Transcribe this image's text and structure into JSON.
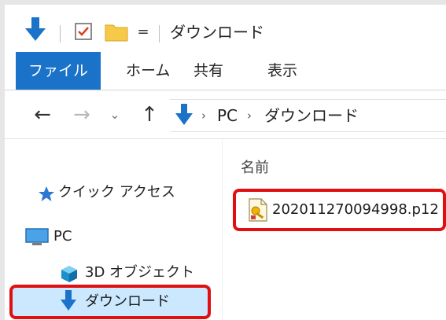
{
  "window": {
    "title": "ダウンロード"
  },
  "quick_access_toolbar": {
    "dropdown_glyph": "="
  },
  "ribbon": {
    "tabs": [
      {
        "label": "ファイル",
        "active": true
      },
      {
        "label": "ホーム"
      },
      {
        "label": "共有"
      },
      {
        "label": "表示"
      }
    ],
    "file_tab_color": "#1a73c8"
  },
  "address_bar": {
    "back_glyph": "←",
    "forward_glyph": "→",
    "recent_glyph": "⌄",
    "up_glyph": "↑",
    "crumbs": [
      "PC",
      "ダウンロード"
    ],
    "separator": "›"
  },
  "nav_pane": {
    "items": [
      {
        "label": "クイック アクセス",
        "icon": "star-icon"
      },
      {
        "label": "PC",
        "icon": "computer-icon"
      },
      {
        "label": "3D オブジェクト",
        "icon": "3d-objects-icon"
      },
      {
        "label": "ダウンロード",
        "icon": "download-arrow-icon",
        "selected": true
      }
    ]
  },
  "file_list": {
    "column_name": "名前",
    "files": [
      {
        "name": "202011270094998.p12",
        "icon": "certificate-file-icon"
      }
    ]
  },
  "highlight_color": "#e01010"
}
